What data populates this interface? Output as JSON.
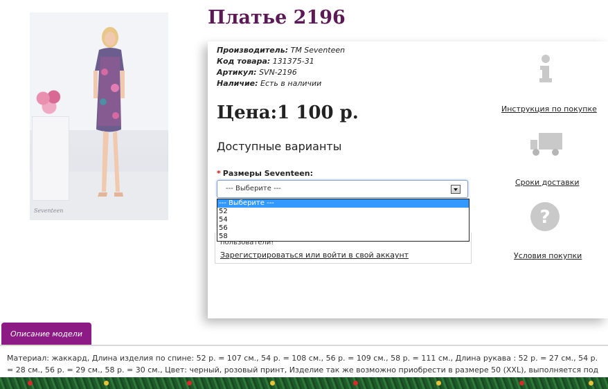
{
  "product": {
    "title": "Платье 2196",
    "image_signature": "Seventeen",
    "meta": {
      "manufacturer_label": "Производитель:",
      "manufacturer_value": "TM Seventeen",
      "code_label": "Код товара:",
      "code_value": "131375-31",
      "sku_label": "Артикул:",
      "sku_value": "SVN-2196",
      "availability_label": "Наличие:",
      "availability_value": "Есть в наличии"
    },
    "price": "Цена:1 100 р.",
    "variants_title": "Доступные варианты",
    "size_required_mark": "*",
    "size_label": "Размеры Seventeen:",
    "size_select": {
      "selected": "--- Выберите ---",
      "options": [
        "--- Выберите ---",
        "52",
        "54",
        "56",
        "58"
      ]
    },
    "login_text": "пользователи!",
    "login_link": "Зарегистрироваться или войти в свой аккаунт"
  },
  "sidebar": {
    "instruction": {
      "icon": "info-icon",
      "label": "Инструкция по покупке"
    },
    "delivery": {
      "icon": "truck-icon",
      "label": "Сроки доставки"
    },
    "terms": {
      "icon": "question-icon",
      "label": "Условия покупки"
    }
  },
  "description": {
    "tab_label": "Описание модели",
    "text": "Материал: жаккард, Длина изделия по спине: 52 р. = 107 см., 54 р. = 108 см., 56 р. = 109 см., 58 р. = 111 см., Длина рукава : 52 р. = 27 см., 54 р. = 28 см., 56 р. = 29 см., 58 р. = 30 см., Цвет: черный, розовый принт, Изделие так же возможно приобрести в размере 50 (XXL), выполняется под заказ!"
  },
  "colors": {
    "title": "#5b1a55",
    "tab": "#8d1b86",
    "required": "#d01515",
    "selected_option": "#3399ff"
  }
}
